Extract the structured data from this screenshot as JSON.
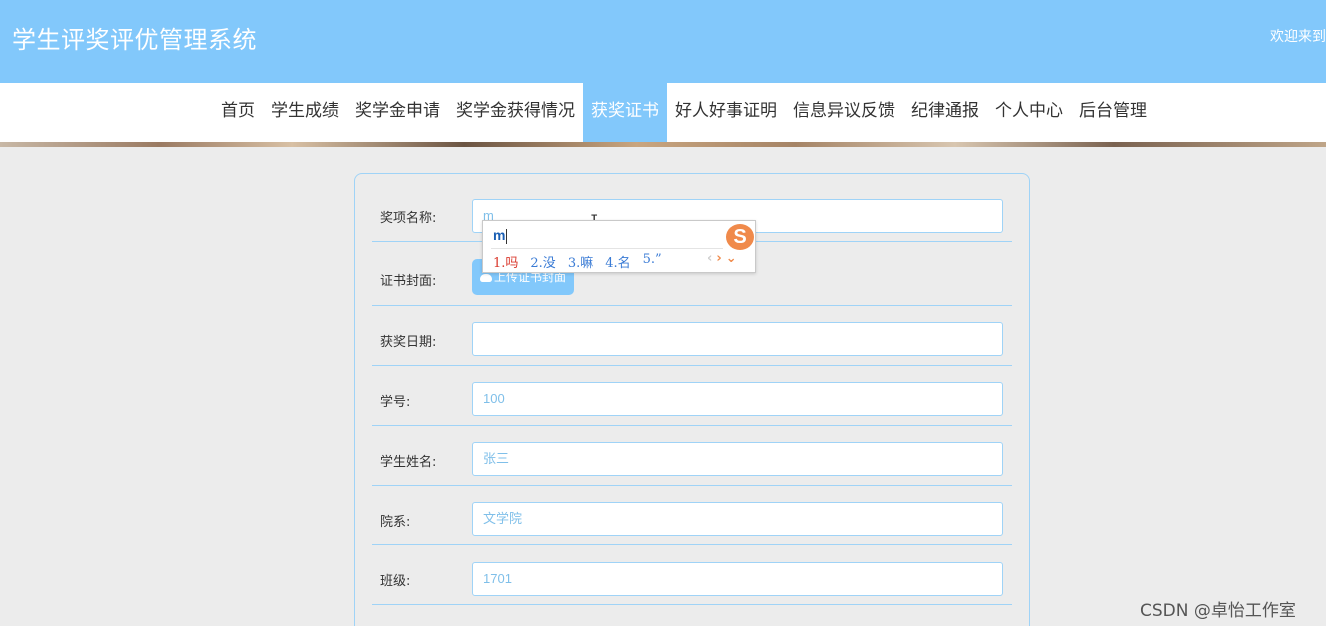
{
  "header": {
    "site_title": "学生评奖评优管理系统",
    "welcome": "欢迎来到"
  },
  "nav": {
    "items": [
      {
        "label": "首页",
        "active": false
      },
      {
        "label": "学生成绩",
        "active": false
      },
      {
        "label": "奖学金申请",
        "active": false
      },
      {
        "label": "奖学金获得情况",
        "active": false
      },
      {
        "label": "获奖证书",
        "active": true
      },
      {
        "label": "好人好事证明",
        "active": false
      },
      {
        "label": "信息异议反馈",
        "active": false
      },
      {
        "label": "纪律通报",
        "active": false
      },
      {
        "label": "个人中心",
        "active": false
      },
      {
        "label": "后台管理",
        "active": false
      }
    ]
  },
  "form": {
    "award_name": {
      "label": "奖项名称:",
      "value": "m"
    },
    "cover": {
      "label": "证书封面:",
      "button": "上传证书封面"
    },
    "date": {
      "label": "获奖日期:",
      "value": ""
    },
    "student_id": {
      "label": "学号:",
      "value": "100"
    },
    "student_name": {
      "label": "学生姓名:",
      "value": "张三"
    },
    "department": {
      "label": "院系:",
      "value": "文学院"
    },
    "class": {
      "label": "班级:",
      "value": "1701"
    }
  },
  "ime": {
    "composition": "m",
    "logo": "S",
    "candidates": [
      "1.吗",
      "2.没",
      "3.嘛",
      "4.名",
      "5.”"
    ],
    "prev": "‹",
    "next": "›",
    "more": "⌄"
  },
  "watermark": "CSDN @卓怡工作室",
  "colors": {
    "header_bg": "#82c8fb",
    "accent": "#82c8fb",
    "border": "#9fd3f7"
  }
}
